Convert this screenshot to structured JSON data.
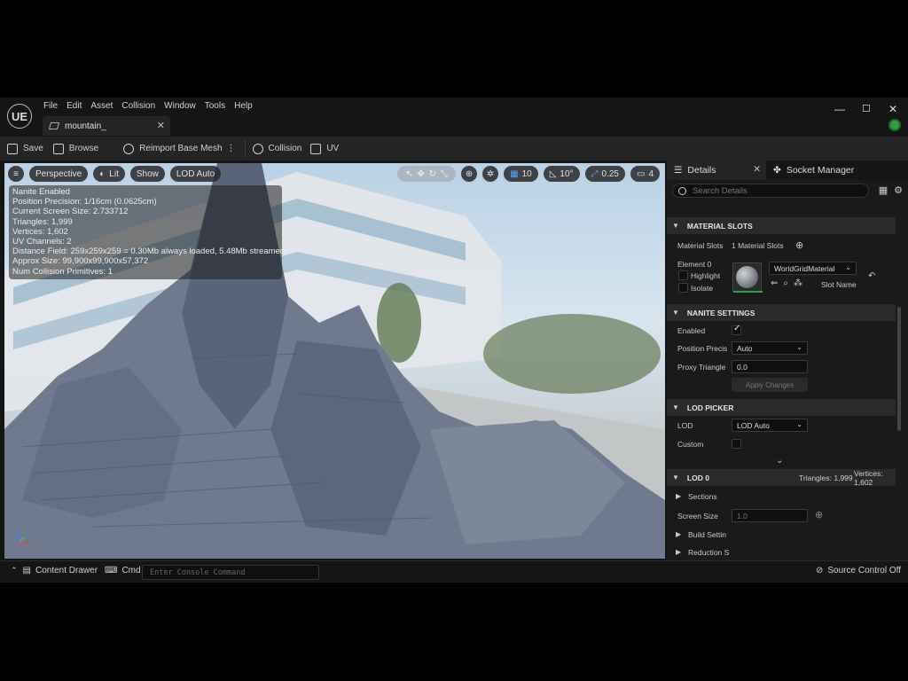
{
  "window": {
    "logo": "UE",
    "menu": [
      "File",
      "Edit",
      "Asset",
      "Collision",
      "Window",
      "Tools",
      "Help"
    ],
    "tab_title": "mountain_",
    "controls": {
      "minimize": "—",
      "maximize": "☐",
      "close": "✕"
    }
  },
  "toolbar": {
    "save": "Save",
    "browse": "Browse",
    "reimport": "Reimport Base Mesh",
    "collision": "Collision",
    "uv": "UV"
  },
  "viewport": {
    "menu_icon": "hamburger-icon",
    "perspective": "Perspective",
    "lit": "Lit",
    "show": "Show",
    "lod": "LOD Auto",
    "grid_snap": "10",
    "rotation_snap": "10°",
    "scale_snap": "0.25",
    "camera_speed": "4",
    "stats": [
      "Nanite Enabled",
      "Position Precision: 1/16cm (0.0625cm)",
      "Current Screen Size:  2.733712",
      "Triangles:  1,999",
      "Vertices:  1,602",
      "UV Channels:  2",
      "Distance Field:  259x259x259 = 0.30Mb always loaded, 5.48Mb streamed",
      "Approx Size: 99,900x99,900x57,372",
      "Num Collision Primitives:  1"
    ]
  },
  "details": {
    "tab_details": "Details",
    "tab_socket": "Socket Manager",
    "search_placeholder": "Search Details",
    "material_slots": {
      "header": "MATERIAL SLOTS",
      "label": "Material Slots",
      "value": "1 Material Slots",
      "element": "Element 0",
      "highlight": "Highlight",
      "isolate": "Isolate",
      "material": "WorldGridMaterial",
      "slot_name": "Slot Name"
    },
    "nanite": {
      "header": "NANITE SETTINGS",
      "enabled": "Enabled",
      "position_precision": "Position Precis",
      "position_value": "Auto",
      "proxy_triangle": "Proxy Triangle",
      "proxy_value": "0.0",
      "apply": "Apply Changes"
    },
    "lod_picker": {
      "header": "LOD PICKER",
      "lod": "LOD",
      "lod_value": "LOD Auto",
      "custom": "Custom"
    },
    "lod0": {
      "header": "LOD 0",
      "triangles": "Triangles: 1,999",
      "vertices": "Vertices: 1,602",
      "sections": "Sections",
      "screen_size": "Screen Size",
      "screen_size_value": "1.0",
      "build_settings": "Build Settin",
      "reduction": "Reduction S"
    }
  },
  "statusbar": {
    "content_drawer": "Content Drawer",
    "cmd": "Cmd",
    "console_placeholder": "Enter Console Command",
    "source_control": "Source Control Off"
  }
}
